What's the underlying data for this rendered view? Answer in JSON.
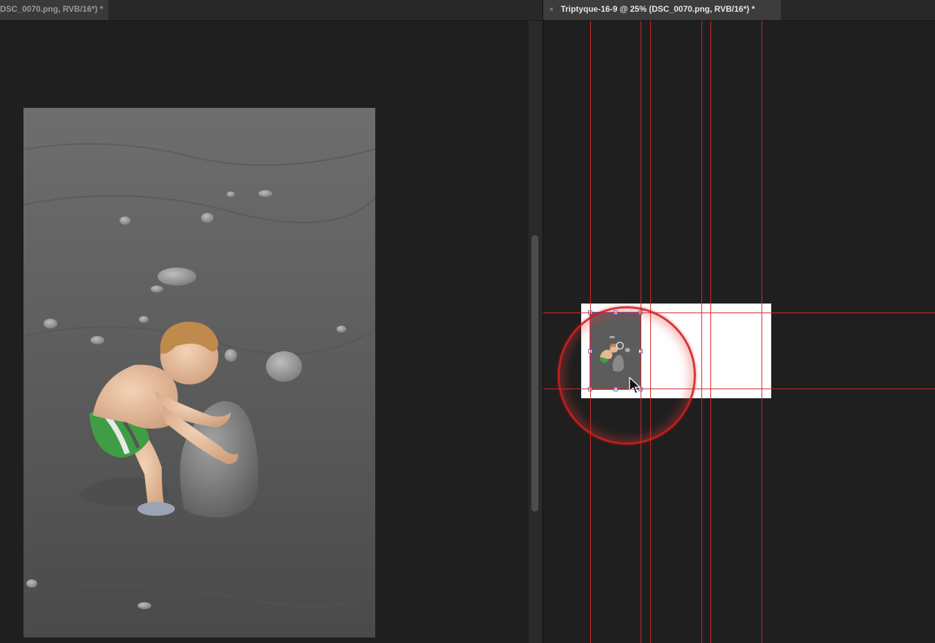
{
  "left_document": {
    "tab_label": "DSC_0070.png, RVB/16*) *"
  },
  "right_document": {
    "tab_close": "×",
    "tab_label": "Triptyque-16-9 @ 25% (DSC_0070.png, RVB/16*) *"
  },
  "colors": {
    "guide": "#d22a2a",
    "selection": "#3b7be0",
    "canvas_bg": "#1f1f1f",
    "tab_bg": "#282828"
  },
  "icons": {
    "tab_close": "close-icon",
    "cursor": "arrow-cursor-icon",
    "highlight": "click-highlight-ring"
  }
}
